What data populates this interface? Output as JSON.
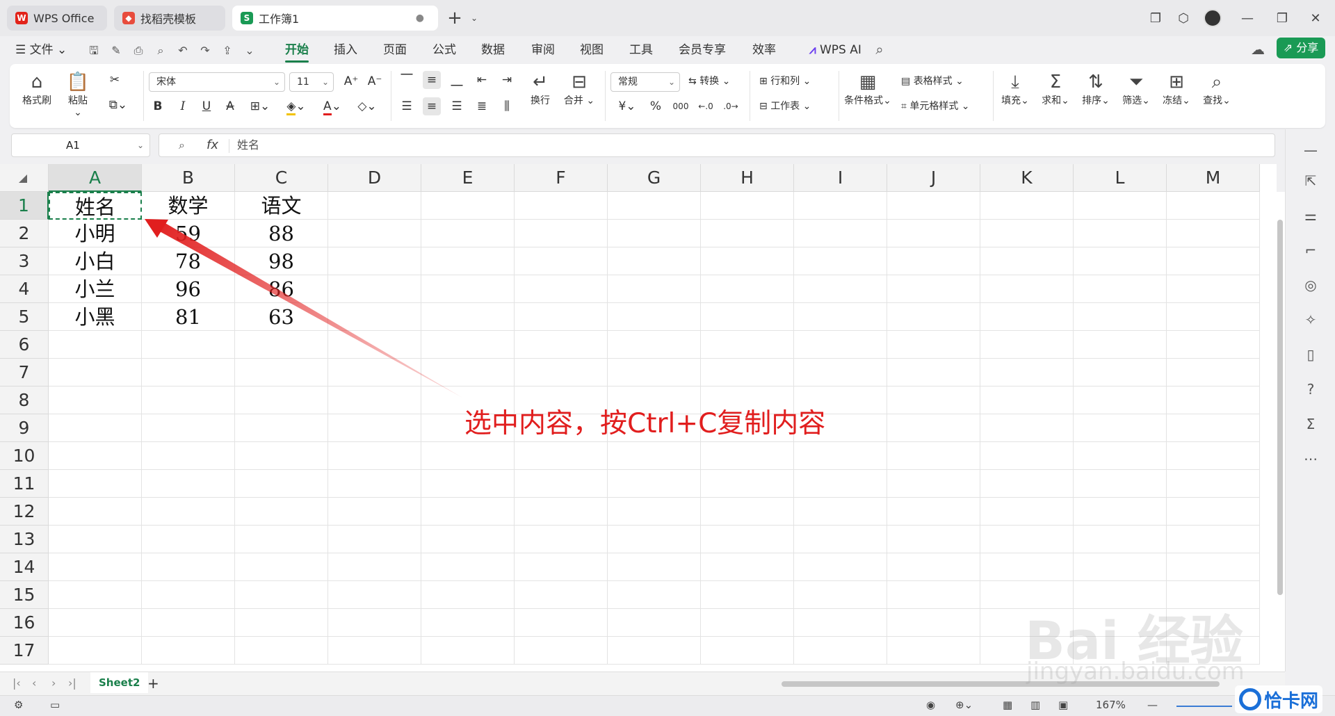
{
  "titlebar": {
    "tabs": [
      {
        "label": "WPS Office",
        "icon": "wps-logo-icon"
      },
      {
        "label": "找稻壳模板",
        "icon": "docer-icon"
      },
      {
        "label": "工作簿1",
        "icon": "spreadsheet-icon"
      }
    ],
    "new_tab": "+"
  },
  "menubar": {
    "file": "文件",
    "items": [
      "开始",
      "插入",
      "页面",
      "公式",
      "数据",
      "审阅",
      "视图",
      "工具",
      "会员专享",
      "效率"
    ],
    "active": "开始",
    "ai": "WPS AI",
    "share": "分享"
  },
  "ribbon": {
    "format_painter": "格式刷",
    "paste": "粘贴",
    "font_name": "宋体",
    "font_size": "11",
    "bold": "B",
    "italic": "I",
    "underline": "U",
    "wrap": "换行",
    "merge": "合并",
    "number_format": "常规",
    "convert": "转换",
    "rows_cols": "行和列",
    "table_style": "表格样式",
    "worksheet": "工作表",
    "cond_format": "条件格式",
    "cell_style": "单元格样式",
    "fill": "填充",
    "sum": "求和",
    "sort": "排序",
    "filter": "筛选",
    "freeze": "冻结",
    "find": "查找",
    "currency": "¥",
    "percent": "%"
  },
  "formula": {
    "name_box": "A1",
    "fx": "fx",
    "value": "姓名"
  },
  "grid": {
    "columns": [
      "A",
      "B",
      "C",
      "D",
      "E",
      "F",
      "G",
      "H",
      "I",
      "J",
      "K",
      "L",
      "M"
    ],
    "rows": [
      "1",
      "2",
      "3",
      "4",
      "5",
      "6",
      "7",
      "8",
      "9",
      "10",
      "11",
      "12",
      "13",
      "14",
      "15",
      "16",
      "17"
    ],
    "cells": [
      [
        "姓名",
        "数学",
        "语文"
      ],
      [
        "小明",
        "59",
        "88"
      ],
      [
        "小白",
        "78",
        "98"
      ],
      [
        "小兰",
        "96",
        "86"
      ],
      [
        "小黑",
        "81",
        "63"
      ]
    ]
  },
  "sheets": {
    "active": "Sheet2"
  },
  "status": {
    "zoom": "167%"
  },
  "annotation": {
    "text": "选中内容，按Ctrl+C复制内容",
    "color": "#e11e1e"
  },
  "watermark": {
    "line1": "Bai 经验",
    "line2": "jingyan.baidu.com",
    "brand": "恰卡网"
  },
  "colors": {
    "accent": "#1a7f4b"
  }
}
